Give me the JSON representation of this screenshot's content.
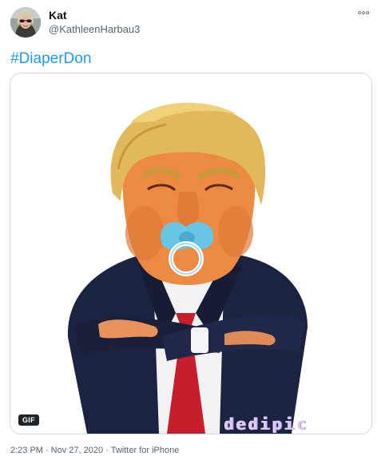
{
  "author": {
    "display_name": "Kat",
    "handle": "@KathleenHarbau3"
  },
  "tweet": {
    "text": "#DiaperDon"
  },
  "media": {
    "badge": "GIF",
    "watermark": "dedipic"
  },
  "meta": {
    "time": "2:23 PM",
    "separator": "·",
    "date": "Nov 27, 2020",
    "source": "Twitter for iPhone"
  },
  "icons": {
    "more": "more-horizontal-icon",
    "avatar": "profile-photo"
  },
  "colors": {
    "link": "#1d9bf0",
    "secondary_text": "#536471",
    "border": "#cfd9de"
  }
}
